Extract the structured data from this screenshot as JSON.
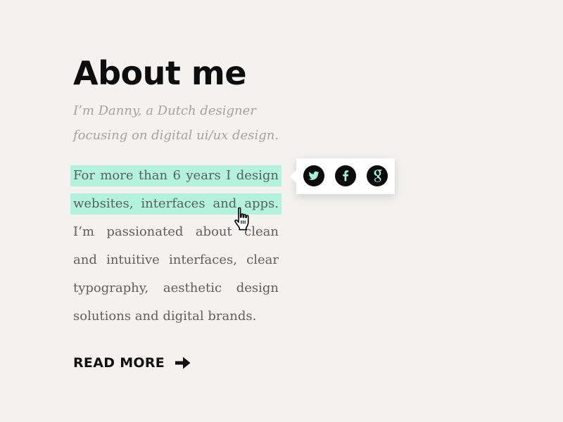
{
  "header": {
    "title": "About me"
  },
  "intro": {
    "lines": [
      "I’m Danny, a Dutch designer",
      "focusing on digital ui/ux design."
    ]
  },
  "body": {
    "highlighted_lines": [
      "For more than 6 years I design",
      "websites, interfaces and apps."
    ],
    "lines": [
      "I’m passionated about clean",
      "and intuitive interfaces, clear",
      "typography, aesthetic design",
      "solutions and digital brands."
    ]
  },
  "share_popup": {
    "buttons": [
      {
        "icon": "twitter-icon"
      },
      {
        "icon": "facebook-icon"
      },
      {
        "icon": "google-icon"
      }
    ]
  },
  "read_more": {
    "label": "READ MORE",
    "icon": "arrow-right-icon"
  },
  "colors": {
    "background": "#f3f2f0",
    "highlight": "#b4f2dd",
    "heading": "#0d0d0d",
    "intro": "#a3a3a3",
    "body": "#5f5e5c",
    "share_icon_glyph": "#a8f0de"
  }
}
